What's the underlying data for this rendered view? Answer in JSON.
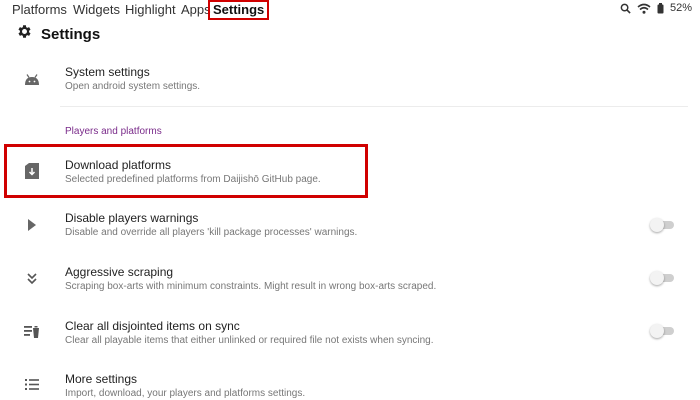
{
  "tabs": [
    {
      "label": "Platforms"
    },
    {
      "label": "Widgets"
    },
    {
      "label": "Highlight"
    },
    {
      "label": "Apps"
    },
    {
      "label": "Settings",
      "active": true
    }
  ],
  "status": {
    "battery": "52%",
    "icons": [
      "search-icon",
      "wifi-icon",
      "battery-icon"
    ]
  },
  "header": {
    "title": "Settings",
    "icon": "gear-icon"
  },
  "system": {
    "title": "System settings",
    "subtitle": "Open android system settings.",
    "icon": "android-icon"
  },
  "section": {
    "label": "Players and platforms"
  },
  "items": [
    {
      "title": "Download platforms",
      "subtitle": "Selected predefined platforms from Daijishō GitHub page.",
      "icon": "download-file-icon"
    },
    {
      "title": "Disable players warnings",
      "subtitle": "Disable and override all players 'kill package processes' warnings.",
      "icon": "play-icon",
      "toggle": false
    },
    {
      "title": "Aggressive scraping",
      "subtitle": "Scraping box-arts with minimum constraints. Might result in wrong box-arts scraped.",
      "icon": "double-chevron-down-icon",
      "toggle": false
    },
    {
      "title": "Clear all disjointed items on sync",
      "subtitle": "Clear all playable items that either unlinked or required file not exists when syncing.",
      "icon": "clear-list-icon",
      "toggle": false
    },
    {
      "title": "More settings",
      "subtitle": "Import, download, your players and platforms settings.",
      "icon": "list-icon"
    }
  ],
  "colors": {
    "accent_section": "#7a2b8a",
    "highlight_border": "#d00000"
  }
}
